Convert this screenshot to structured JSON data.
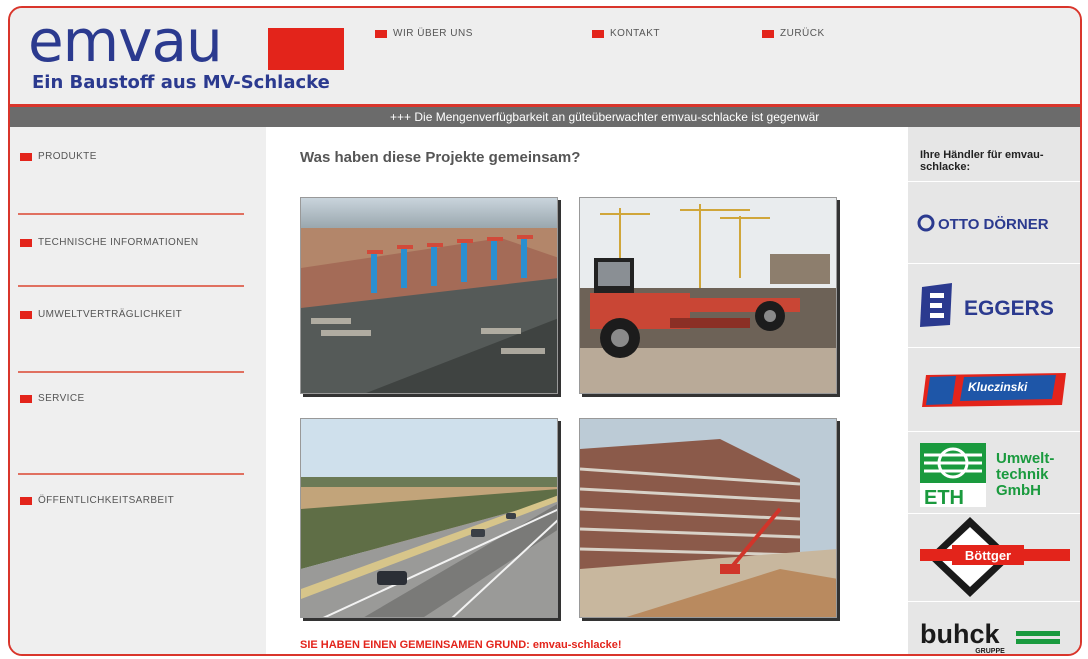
{
  "header": {
    "logo_word": "emvau",
    "logo_tagline": "Ein Baustoff aus MV-Schlacke",
    "nav": [
      {
        "label": "WIR ÜBER UNS"
      },
      {
        "label": "KONTAKT"
      },
      {
        "label": "ZURÜCK"
      }
    ]
  },
  "ticker": {
    "text": "+++ Die Mengenverfügbarkeit an güteüberwachter emvau-schlacke ist gegenwär"
  },
  "sidebar": {
    "items": [
      {
        "label": "PRODUKTE"
      },
      {
        "label": "TECHNISCHE INFORMATIONEN"
      },
      {
        "label": "UMWELTVERTRÄGLICHKEIT"
      },
      {
        "label": "SERVICE"
      },
      {
        "label": "ÖFFENTLICHKEITSARBEIT"
      }
    ]
  },
  "main": {
    "title": "Was haben diese Projekte gemeinsam?",
    "footer": "SIE HABEN EINEN GEMEINSAMEN GRUND: emvau-schlacke!"
  },
  "right": {
    "title": "Ihre Händler für emvau-schlacke:",
    "dealers": [
      {
        "name": "OTTO DÖRNER"
      },
      {
        "name": "EGGERS"
      },
      {
        "name": "Kluczinski"
      },
      {
        "name_line1": "Umwelt-",
        "name_line2": "technik",
        "name_line3": "GmbH",
        "abbr": "ETH"
      },
      {
        "name": "Böttger"
      },
      {
        "name": "buhck",
        "sub": "GRUPPE"
      }
    ]
  },
  "colors": {
    "accent_red": "#e3241b",
    "brand_blue": "#2b3a8f",
    "ticker_bg": "#6b6b6b"
  }
}
